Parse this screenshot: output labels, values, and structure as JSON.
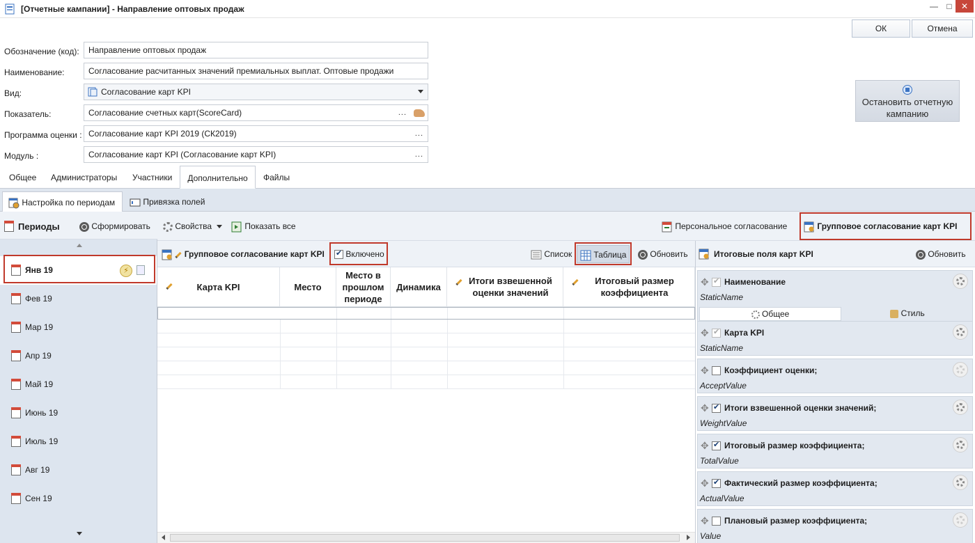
{
  "window": {
    "title": "[Отчетные кампании] - Направление оптовых продаж",
    "ok_label": "ОК",
    "cancel_label": "Отмена"
  },
  "form": {
    "code_label": "Обозначение (код):",
    "code_value": "Направление оптовых продаж",
    "name_label": "Наименование:",
    "name_value": "Согласование расчитанных значений премиальных выплат. Оптовые продажи",
    "type_label": "Вид:",
    "type_value": "Согласование карт KPI",
    "indicator_label": "Показатель:",
    "indicator_value": "Согласование счетных карт(ScoreCard)",
    "program_label": "Программа оценки :",
    "program_value": "Согласование карт KPI 2019 (СК2019)",
    "module_label": "Модуль :",
    "module_value": "Согласование карт KPI (Согласование карт KPI)",
    "dots": "...",
    "stop_button": "Остановить отчетную кампанию"
  },
  "tabs": [
    {
      "label": "Общее"
    },
    {
      "label": "Администраторы"
    },
    {
      "label": "Участники"
    },
    {
      "label": "Дополнительно"
    },
    {
      "label": "Файлы"
    }
  ],
  "subtabs": [
    {
      "label": "Настройка по периодам"
    },
    {
      "label": "Привязка полей"
    }
  ],
  "periods": {
    "title": "Периоды",
    "generate": "Сформировать",
    "items": [
      {
        "label": "Янв 19"
      },
      {
        "label": "Фев 19"
      },
      {
        "label": "Мар 19"
      },
      {
        "label": "Апр 19"
      },
      {
        "label": "Май 19"
      },
      {
        "label": "Июнь 19"
      },
      {
        "label": "Июль 19"
      },
      {
        "label": "Авг 19"
      },
      {
        "label": "Сен 19"
      }
    ]
  },
  "toolbar": {
    "properties": "Свойства",
    "show_all": "Показать все",
    "personal": "Персональное согласование",
    "group": "Групповое согласование карт KPI"
  },
  "grid_toolbar": {
    "title": "Групповое согласование карт KPI",
    "enabled": "Включено",
    "list": "Список",
    "table": "Таблица",
    "refresh": "Обновить"
  },
  "grid": {
    "columns": [
      {
        "label": "Карта KPI"
      },
      {
        "label": "Место"
      },
      {
        "label": "Место в прошлом периоде"
      },
      {
        "label": "Динамика"
      },
      {
        "label": "Итоги взвешенной оценки значений"
      },
      {
        "label": "Итоговый размер коэффициента"
      }
    ]
  },
  "right": {
    "title": "Итоговые поля карт KPI",
    "refresh": "Обновить",
    "tab_general": "Общее",
    "tab_style": "Стиль",
    "fields": [
      {
        "name": "Наименование",
        "sub": "StaticName",
        "checked": true
      },
      {
        "name": "Карта KPI",
        "sub": "StaticName",
        "checked": true
      },
      {
        "name": "Коэффициент оценки;",
        "sub": "AcceptValue",
        "checked": false
      },
      {
        "name": "Итоги взвешенной оценки значений;",
        "sub": "WeightValue",
        "checked": true
      },
      {
        "name": "Итоговый размер коэффициента;",
        "sub": "TotalValue",
        "checked": true
      },
      {
        "name": "Фактический размер коэффициента;",
        "sub": "ActualValue",
        "checked": true
      },
      {
        "name": "Плановый размер коэффициента;",
        "sub": "Value",
        "checked": false
      }
    ]
  }
}
